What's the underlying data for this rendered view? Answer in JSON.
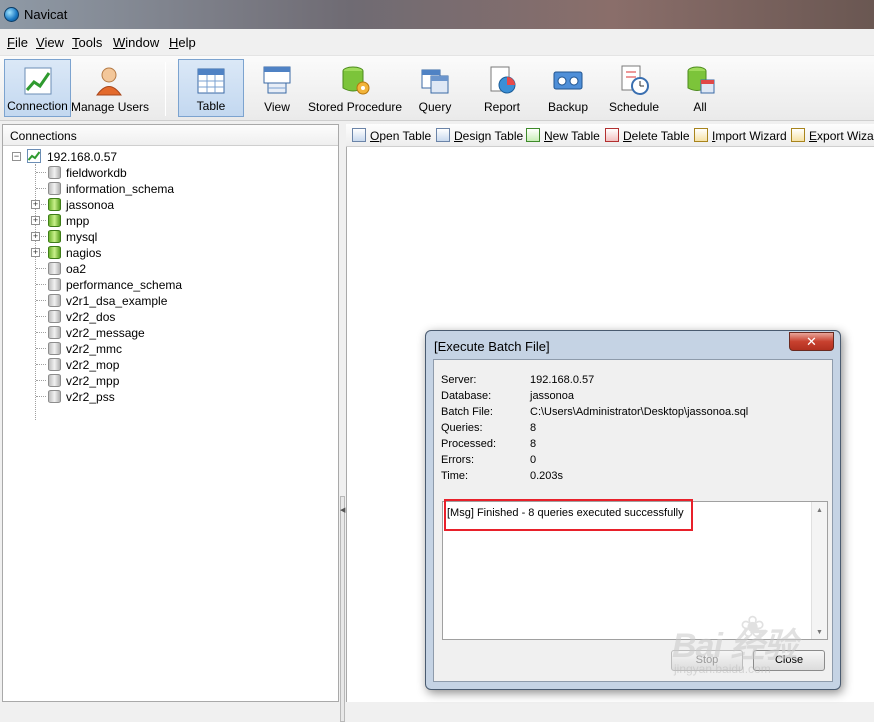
{
  "window": {
    "title": "Navicat"
  },
  "menu": [
    "File",
    "View",
    "Tools",
    "Window",
    "Help"
  ],
  "toolbar": {
    "buttons": [
      {
        "label": "Connection",
        "icon": "connection-chart-icon"
      },
      {
        "label": "Manage Users",
        "icon": "user-icon"
      },
      {
        "label": "Table",
        "icon": "table-grid-icon"
      },
      {
        "label": "View",
        "icon": "view-grid-icon"
      },
      {
        "label": "Stored Procedure",
        "icon": "procedure-gear-icon"
      },
      {
        "label": "Query",
        "icon": "query-icon"
      },
      {
        "label": "Report",
        "icon": "report-icon"
      },
      {
        "label": "Backup",
        "icon": "backup-tape-icon"
      },
      {
        "label": "Schedule",
        "icon": "schedule-clock-icon"
      },
      {
        "label": "All",
        "icon": "all-objects-icon"
      }
    ]
  },
  "connections": {
    "header": "Connections",
    "server": "192.168.0.57",
    "databases": [
      {
        "name": "fieldworkdb",
        "open": false
      },
      {
        "name": "information_schema",
        "open": false
      },
      {
        "name": "jassonoa",
        "open": true
      },
      {
        "name": "mpp",
        "open": true
      },
      {
        "name": "mysql",
        "open": true
      },
      {
        "name": "nagios",
        "open": true
      },
      {
        "name": "oa2",
        "open": false
      },
      {
        "name": "performance_schema",
        "open": false
      },
      {
        "name": "v2r1_dsa_example",
        "open": false
      },
      {
        "name": "v2r2_dos",
        "open": false
      },
      {
        "name": "v2r2_message",
        "open": false
      },
      {
        "name": "v2r2_mmc",
        "open": false
      },
      {
        "name": "v2r2_mop",
        "open": false
      },
      {
        "name": "v2r2_mpp",
        "open": false
      },
      {
        "name": "v2r2_pss",
        "open": false
      }
    ]
  },
  "object_toolbar": {
    "buttons": [
      "Open Table",
      "Design Table",
      "New Table",
      "Delete Table",
      "Import Wizard",
      "Export Wizard"
    ]
  },
  "dialog": {
    "title": "[Execute Batch File]",
    "close_glyph": "✕",
    "rows": [
      {
        "key": "Server:",
        "value": "192.168.0.57"
      },
      {
        "key": "Database:",
        "value": "jassonoa"
      },
      {
        "key": "Batch File:",
        "value": "C:\\Users\\Administrator\\Desktop\\jassonoa.sql"
      },
      {
        "key": "Queries:",
        "value": "8"
      },
      {
        "key": "Processed:",
        "value": "8"
      },
      {
        "key": "Errors:",
        "value": "0"
      },
      {
        "key": "Time:",
        "value": "0.203s"
      }
    ],
    "message": "[Msg] Finished - 8 queries executed successfully",
    "stop_label": "Stop",
    "close_label": "Close"
  },
  "watermark": {
    "brand": "Bai  经验",
    "url": "jingyan.baidu.com"
  },
  "colors": {
    "highlight": "#e8202a",
    "active_button": "#c3d8f0"
  }
}
